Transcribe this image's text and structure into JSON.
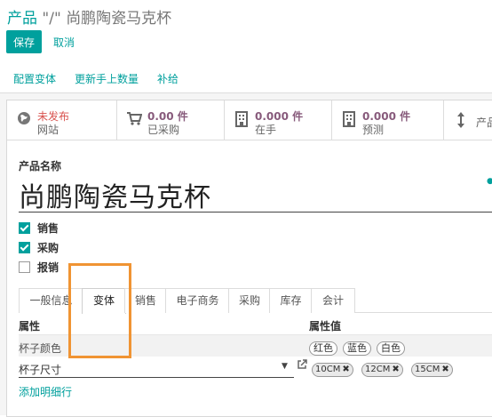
{
  "breadcrumb": {
    "parent": "产品",
    "separator": "\"/\"",
    "current": "尚鹏陶瓷马克杯"
  },
  "buttons": {
    "save": "保存",
    "cancel": "取消"
  },
  "actions": [
    "配置变体",
    "更新手上数量",
    "补给"
  ],
  "stats": [
    {
      "icon": "globe-icon",
      "value": "未发布",
      "label": "网站"
    },
    {
      "icon": "cart-icon",
      "value": "0.00 件",
      "label": "已采购"
    },
    {
      "icon": "building-icon",
      "value": "0.000 件",
      "label": "在手"
    },
    {
      "icon": "building-icon",
      "value": "0.000 件",
      "label": "预测"
    },
    {
      "icon": "updown-arrow-icon",
      "value": "",
      "label": "产品"
    }
  ],
  "form": {
    "name_label": "产品名称",
    "name_value": "尚鹏陶瓷马克杯",
    "checkboxes": [
      {
        "label": "销售",
        "checked": true
      },
      {
        "label": "采购",
        "checked": true
      },
      {
        "label": "报销",
        "checked": false
      }
    ]
  },
  "tabs": [
    "一般信息",
    "变体",
    "销售",
    "电子商务",
    "采购",
    "库存",
    "会计"
  ],
  "active_tab": "变体",
  "variants": {
    "col_attribute": "属性",
    "col_values": "属性值",
    "rows": [
      {
        "attribute": "杯子颜色",
        "values": [
          "红色",
          "蓝色",
          "白色"
        ]
      },
      {
        "attribute": "杯子尺寸",
        "values": [
          "10CM",
          "12CM",
          "15CM"
        ]
      }
    ],
    "add_line": "添加明细行"
  },
  "colors": {
    "accent": "#00a09d",
    "highlight": "#f09433",
    "stat_value": "#875a7b",
    "unpublished": "#d9534f"
  }
}
